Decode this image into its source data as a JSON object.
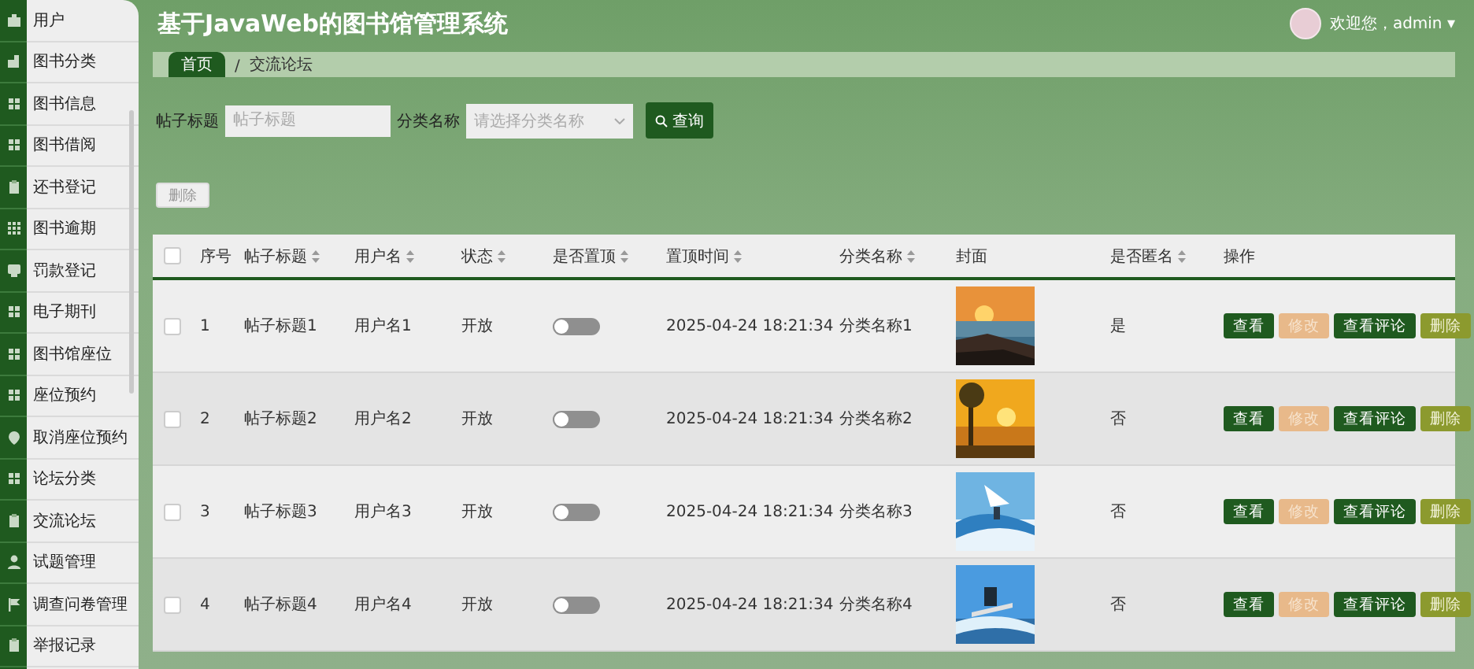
{
  "header": {
    "title": "基于JavaWeb的图书馆管理系统",
    "greeting": "欢迎您，admin",
    "caret": "▾"
  },
  "sidebar": {
    "items": [
      {
        "label": "用户"
      },
      {
        "label": "图书分类"
      },
      {
        "label": "图书信息"
      },
      {
        "label": "图书借阅"
      },
      {
        "label": "还书登记"
      },
      {
        "label": "图书逾期"
      },
      {
        "label": "罚款登记"
      },
      {
        "label": "电子期刊"
      },
      {
        "label": "图书馆座位"
      },
      {
        "label": "座位预约"
      },
      {
        "label": "取消座位预约"
      },
      {
        "label": "论坛分类"
      },
      {
        "label": "交流论坛"
      },
      {
        "label": "试题管理"
      },
      {
        "label": "调查问卷管理"
      },
      {
        "label": "举报记录"
      }
    ]
  },
  "breadcrumb": {
    "items": [
      "首页",
      "交流论坛"
    ],
    "separator": "/"
  },
  "search": {
    "fields": [
      {
        "kind": "input",
        "label": "帖子标题",
        "placeholder": "帖子标题"
      },
      {
        "kind": "select",
        "label": "分类名称",
        "placeholder": "请选择分类名称"
      }
    ],
    "button": "查询"
  },
  "delete_button": "删除",
  "table": {
    "select_all_checked": false,
    "columns": [
      {
        "label": "序号",
        "sortable": false
      },
      {
        "label": "帖子标题",
        "sortable": true
      },
      {
        "label": "用户名",
        "sortable": true
      },
      {
        "label": "状态",
        "sortable": true
      },
      {
        "label": "是否置顶",
        "sortable": true
      },
      {
        "label": "置顶时间",
        "sortable": true
      },
      {
        "label": "分类名称",
        "sortable": true
      },
      {
        "label": "封面",
        "sortable": false
      },
      {
        "label": "是否匿名",
        "sortable": true
      },
      {
        "label": "操作",
        "sortable": false
      }
    ],
    "rows": [
      {
        "checked": false,
        "index": "1",
        "title": "帖子标题1",
        "user": "用户名1",
        "status": "开放",
        "pinned": false,
        "time": "2025-04-24 18:21:34",
        "category": "分类名称1",
        "anonymous": "是",
        "actions": [
          {
            "kind": "view",
            "label": "查看"
          },
          {
            "kind": "edit",
            "label": "修改"
          },
          {
            "kind": "comments",
            "label": "查看评论"
          },
          {
            "kind": "delete",
            "label": "删除"
          }
        ]
      },
      {
        "checked": false,
        "index": "2",
        "title": "帖子标题2",
        "user": "用户名2",
        "status": "开放",
        "pinned": false,
        "time": "2025-04-24 18:21:34",
        "category": "分类名称2",
        "anonymous": "否",
        "actions": [
          {
            "kind": "view",
            "label": "查看"
          },
          {
            "kind": "edit",
            "label": "修改"
          },
          {
            "kind": "comments",
            "label": "查看评论"
          },
          {
            "kind": "delete",
            "label": "删除"
          }
        ]
      },
      {
        "checked": false,
        "index": "3",
        "title": "帖子标题3",
        "user": "用户名3",
        "status": "开放",
        "pinned": false,
        "time": "2025-04-24 18:21:34",
        "category": "分类名称3",
        "anonymous": "否",
        "actions": [
          {
            "kind": "view",
            "label": "查看"
          },
          {
            "kind": "edit",
            "label": "修改"
          },
          {
            "kind": "comments",
            "label": "查看评论"
          },
          {
            "kind": "delete",
            "label": "删除"
          }
        ]
      },
      {
        "checked": false,
        "index": "4",
        "title": "帖子标题4",
        "user": "用户名4",
        "status": "开放",
        "pinned": false,
        "time": "2025-04-24 18:21:34",
        "category": "分类名称4",
        "anonymous": "否",
        "actions": [
          {
            "kind": "view",
            "label": "查看"
          },
          {
            "kind": "edit",
            "label": "修改"
          },
          {
            "kind": "comments",
            "label": "查看评论"
          },
          {
            "kind": "delete",
            "label": "删除"
          }
        ]
      }
    ]
  }
}
